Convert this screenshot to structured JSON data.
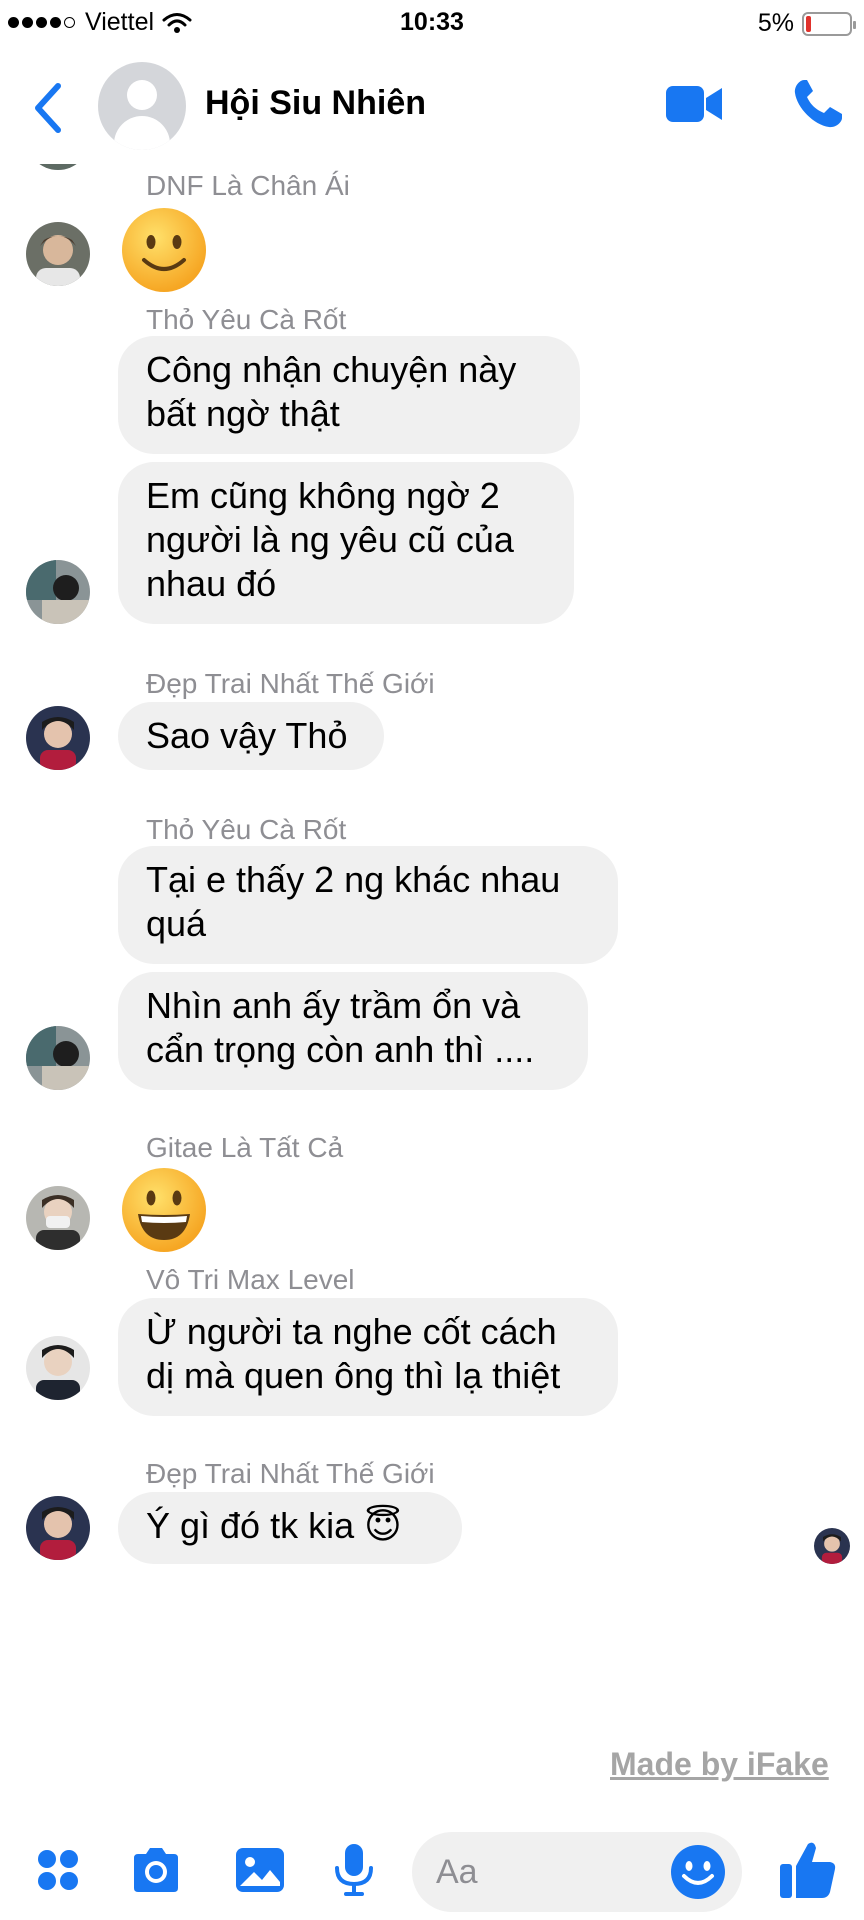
{
  "status_bar": {
    "carrier": "Viettel",
    "time": "10:33",
    "battery": "5%",
    "battery_level": 0.05,
    "signal_bars": 4
  },
  "header": {
    "title": "Hội Siu Nhiên"
  },
  "messages": [
    {
      "sender": "DNF Là Chân Ái",
      "type": "emoji",
      "emoji": "slightly-smiling-face"
    },
    {
      "sender": "Thỏ Yêu Cà Rốt",
      "type": "text",
      "bubbles": [
        "Công nhận chuyện này\nbất ngờ thật",
        "Em cũng không ngờ 2\nngười là ng yêu cũ của\nnhau đó"
      ]
    },
    {
      "sender": "Đẹp Trai Nhất Thế Giới",
      "type": "text",
      "bubbles": [
        "Sao vậy Thỏ"
      ]
    },
    {
      "sender": "Thỏ Yêu Cà Rốt",
      "type": "text",
      "bubbles": [
        "Tại e thấy 2 ng khác nhau\nquá",
        "Nhìn anh ấy trầm ổn và\ncẩn trọng còn anh thì ...."
      ]
    },
    {
      "sender": "Gitae Là Tất Cả",
      "type": "emoji",
      "emoji": "grinning-face"
    },
    {
      "sender": "Vô Tri Max Level",
      "type": "text",
      "bubbles": [
        "Ừ người ta nghe cốt cách\ndị mà quen ông thì lạ thiệt"
      ]
    },
    {
      "sender": "Đẹp Trai Nhất Thế Giới",
      "type": "text",
      "bubbles": [
        "Ý gì đó tk kia 😇"
      ]
    }
  ],
  "watermark": "Made by iFake",
  "composer": {
    "placeholder": "Aa"
  },
  "colors": {
    "accent": "#1877f2",
    "bubble": "#f0f0f0",
    "sender_name": "#8e8e93",
    "emoji_yellow": "#fbc02d"
  }
}
